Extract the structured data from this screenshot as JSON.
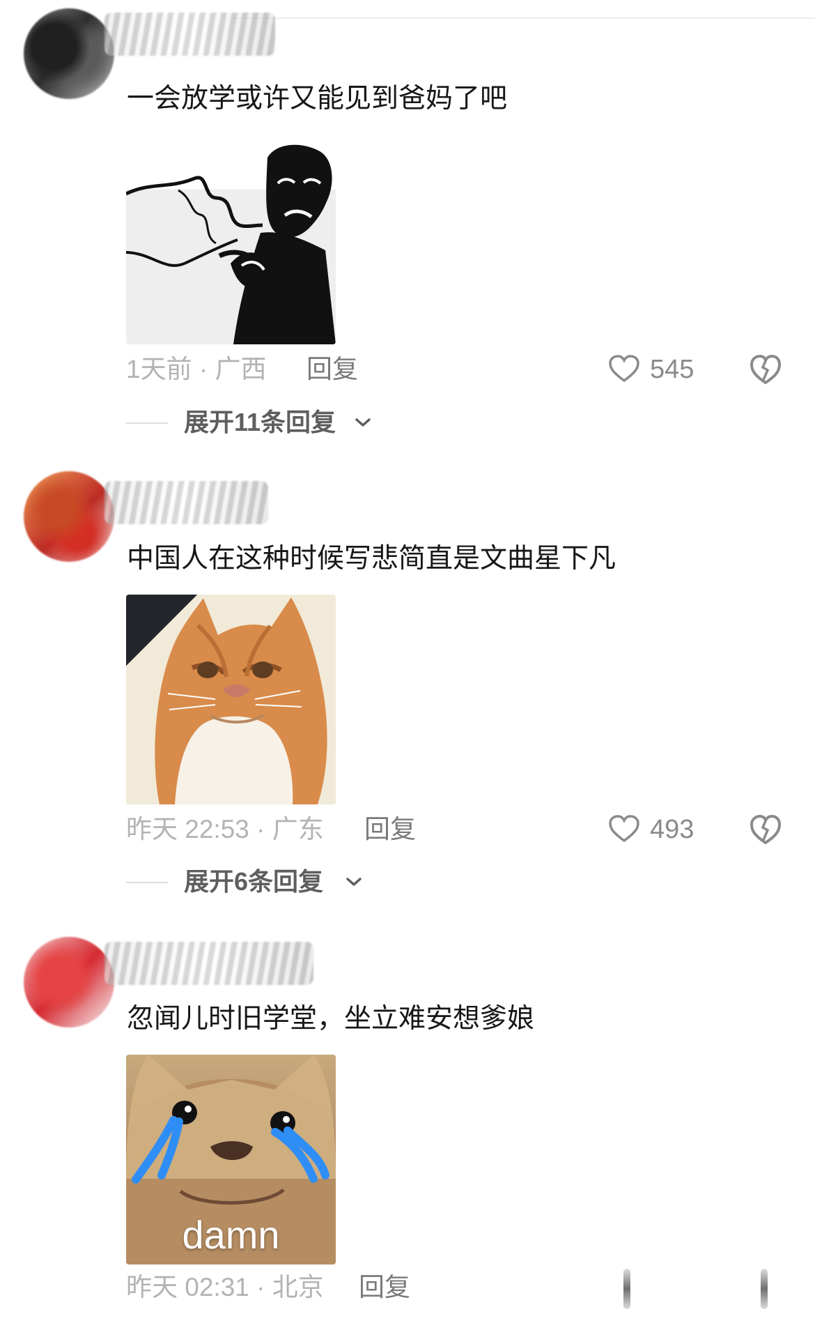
{
  "comments": [
    {
      "text": "一会放学或许又能见到爸妈了吧",
      "meta": "1天前 · 广西",
      "reply": "回复",
      "likes": "545",
      "expand": "展开11条回复"
    },
    {
      "text": "中国人在这种时候写悲简直是文曲星下凡",
      "meta": "昨天 22:53 · 广东",
      "reply": "回复",
      "likes": "493",
      "expand": "展开6条回复"
    },
    {
      "text": "忽闻儿时旧学堂，坐立难安想爹娘",
      "meta": "昨天 02:31 · 北京",
      "reply": "回复",
      "image_caption": "damn"
    }
  ],
  "icons": {
    "like": "heart-icon",
    "dislike": "broken-heart-icon",
    "expand": "chevron-down-icon"
  },
  "colors": {
    "text": "#171717",
    "meta": "#b3b3b3",
    "secondary": "#7a7a7a",
    "divider": "#dddddd",
    "icon": "#8a8a8a",
    "cry_tears": "#2f8ef5"
  }
}
